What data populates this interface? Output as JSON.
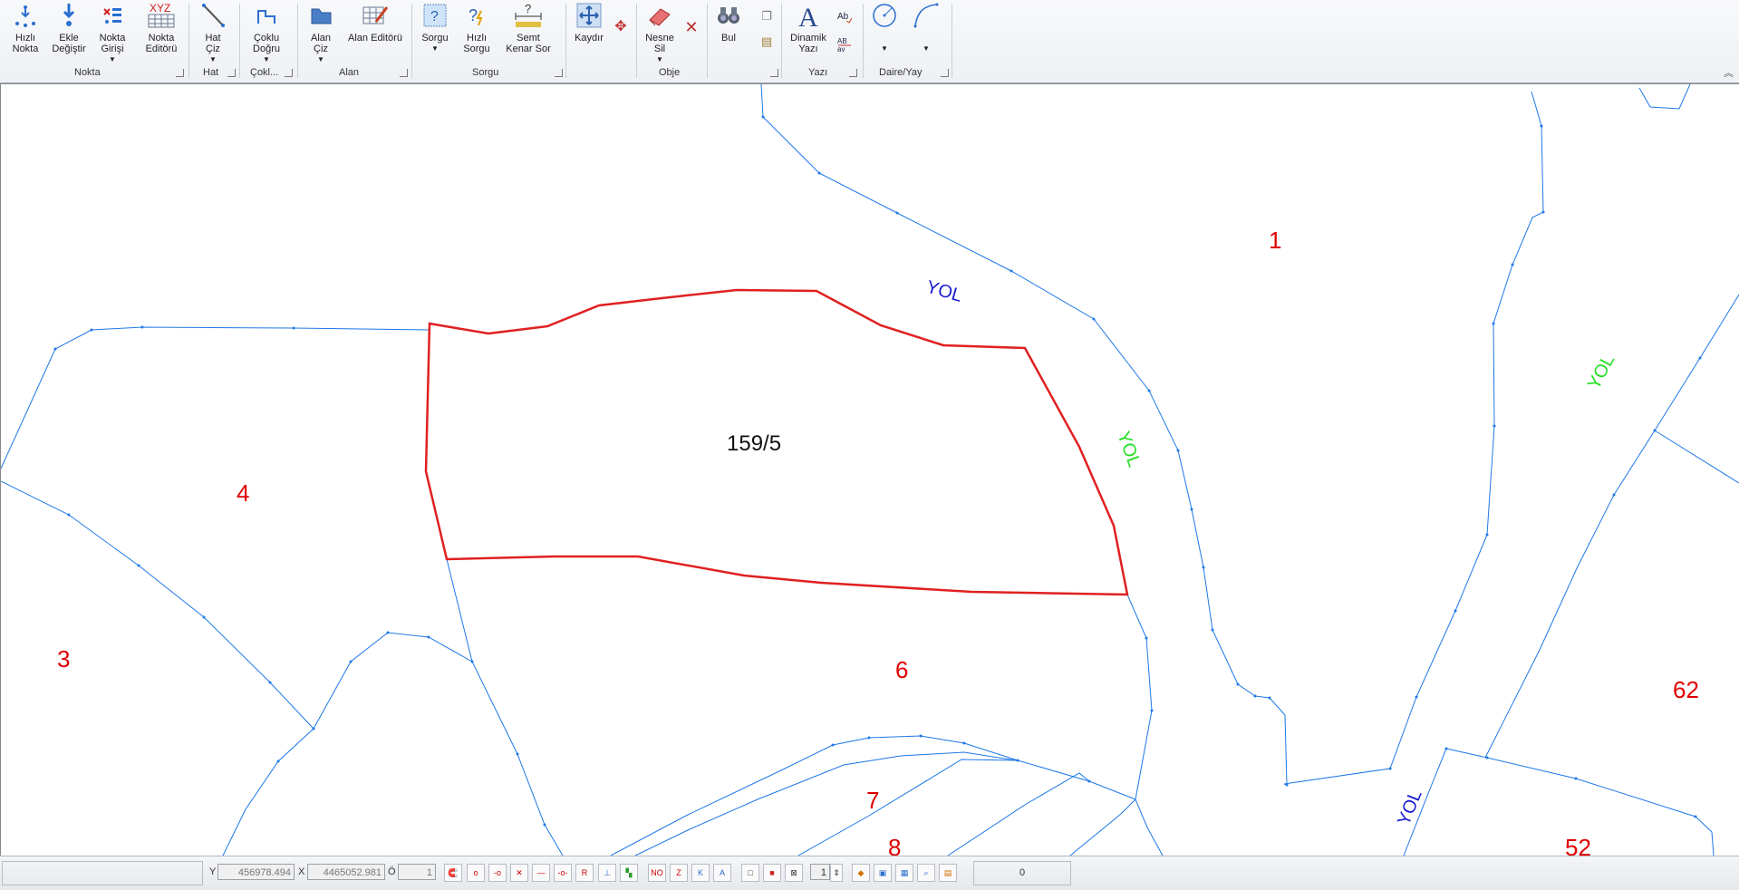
{
  "ribbon": {
    "buttons": [
      {
        "id": "hizli-nokta",
        "label1": "Hızlı",
        "label2": "Nokta",
        "dd": false
      },
      {
        "id": "ekle-degistir",
        "label1": "Ekle",
        "label2": "Değiştir",
        "dd": false
      },
      {
        "id": "nokta-girisi",
        "label1": "Nokta",
        "label2": "Girişi",
        "dd": true
      },
      {
        "id": "nokta-editoru",
        "label1": "Nokta",
        "label2": "Editörü",
        "dd": false
      },
      {
        "id": "hat-ciz",
        "label1": "Hat",
        "label2": "Çiz",
        "dd": true
      },
      {
        "id": "coklu-dogru",
        "label1": "Çoklu",
        "label2": "Doğru",
        "dd": true
      },
      {
        "id": "alan-ciz",
        "label1": "Alan",
        "label2": "Çiz",
        "dd": true
      },
      {
        "id": "alan-editoru",
        "label1": "Alan Editörü",
        "label2": "",
        "dd": false
      },
      {
        "id": "sorgu",
        "label1": "Sorgu",
        "label2": "",
        "dd": true
      },
      {
        "id": "hizli-sorgu",
        "label1": "Hızlı",
        "label2": "Sorgu",
        "dd": false
      },
      {
        "id": "semt-kenar-sor",
        "label1": "Semt",
        "label2": "Kenar Sor",
        "dd": true
      },
      {
        "id": "kaydir",
        "label1": "Kaydır",
        "label2": "",
        "dd": false
      },
      {
        "id": "nesne-sil",
        "label1": "Nesne",
        "label2": "Sil",
        "dd": true
      },
      {
        "id": "bul",
        "label1": "Bul",
        "label2": "",
        "dd": false
      },
      {
        "id": "dinamik-yazi",
        "label1": "Dinamik",
        "label2": "Yazı",
        "dd": false
      }
    ],
    "xyz_text": "XYZ",
    "groups": {
      "nokta": "Nokta",
      "hat": "Hat",
      "coklu": "Çokl...",
      "alan": "Alan",
      "sorgu": "Sorgu",
      "obje": "Obje",
      "yazi": "Yazı",
      "daire_yay": "Daire/Yay"
    }
  },
  "map": {
    "parcel_label": "159/5",
    "parcel_numbers": {
      "p1": "1",
      "p4": "4",
      "p3": "3",
      "p6": "6",
      "p62": "62",
      "p7": "7",
      "p8": "8",
      "p52": "52"
    },
    "road_labels": {
      "yol_blue_top": "YOL",
      "yol_green_mid": "YOL",
      "yol_green_right": "YOL",
      "yol_blue_bottom": "YOL"
    },
    "colors": {
      "line": "#1e78e6",
      "parcel_outline": "#e02020",
      "parcel_number": "#e00000",
      "road_blue": "#1a1ad0",
      "road_green": "#22dd22"
    }
  },
  "statusbar": {
    "y_label": "Y",
    "y_value": "456978.494",
    "x_label": "X",
    "x_value": "4465052.981",
    "o_label": "Ö",
    "o_value": "1",
    "scale_value": "1",
    "count_value": "0"
  }
}
